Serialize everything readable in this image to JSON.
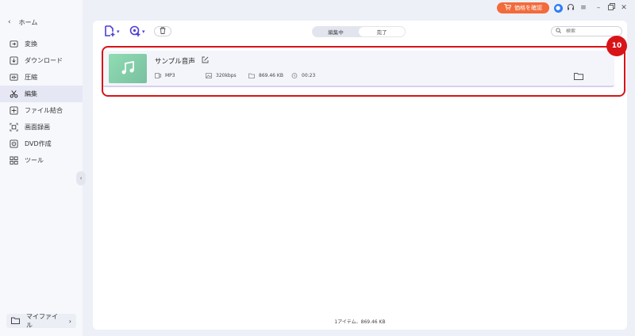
{
  "titlebar": {
    "price_button_label": "価格を確認",
    "accent_color": "#f26b3a"
  },
  "sidebar": {
    "home_label": "ホーム",
    "items": [
      {
        "label": "変換",
        "icon": "convert-icon"
      },
      {
        "label": "ダウンロード",
        "icon": "download-icon"
      },
      {
        "label": "圧縮",
        "icon": "compress-icon"
      },
      {
        "label": "編集",
        "icon": "scissors-icon",
        "active": true
      },
      {
        "label": "ファイル結合",
        "icon": "merge-icon"
      },
      {
        "label": "画面録画",
        "icon": "screen-record-icon"
      },
      {
        "label": "DVD作成",
        "icon": "dvd-icon"
      },
      {
        "label": "ツール",
        "icon": "tools-grid-icon"
      }
    ],
    "my_files_label": "マイファイル"
  },
  "toolbar": {
    "tabs": [
      {
        "label": "編集中",
        "selected": false
      },
      {
        "label": "完了",
        "selected": true
      }
    ],
    "search_placeholder": "検索"
  },
  "file": {
    "name": "サンプル音声",
    "format": "MP3",
    "bitrate": "320kbps",
    "size": "869.46 KB",
    "duration": "00:23"
  },
  "annotation": {
    "badge_number": "10",
    "color": "#d81418"
  },
  "status_bar": "1アイテム、869.46 KB"
}
